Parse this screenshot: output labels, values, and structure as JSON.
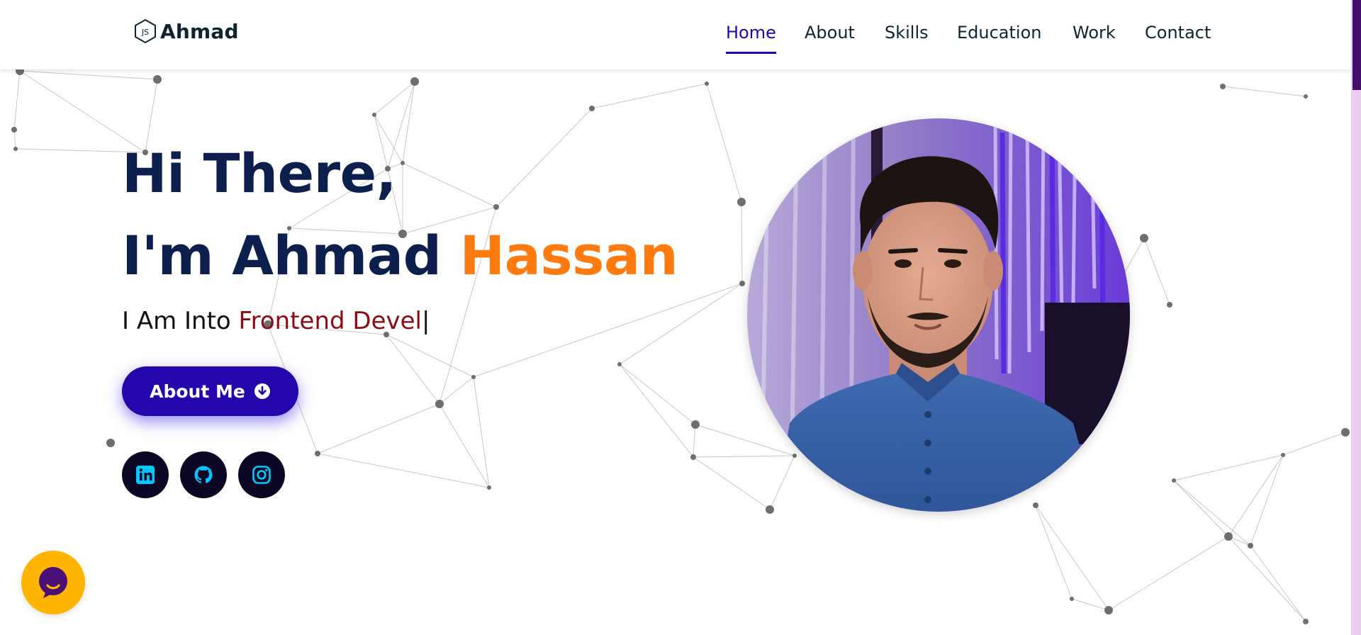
{
  "header": {
    "logo_text": "Ahmad",
    "logo_icon": "js-hexagon-icon",
    "nav": [
      {
        "label": "Home",
        "active": true
      },
      {
        "label": "About",
        "active": false
      },
      {
        "label": "Skills",
        "active": false
      },
      {
        "label": "Education",
        "active": false
      },
      {
        "label": "Work",
        "active": false
      },
      {
        "label": "Contact",
        "active": false
      }
    ]
  },
  "hero": {
    "greeting": "Hi There,",
    "intro_prefix": "I'm Ahmad",
    "intro_highlight": "Hassan",
    "subtitle_prefix": "I Am Into",
    "subtitle_typed": "Frontend Devel",
    "typing_cursor": "|",
    "about_button": {
      "label": "About Me",
      "icon": "arrow-circle-down-icon"
    },
    "socials": [
      {
        "name": "linkedin",
        "icon": "linkedin-icon"
      },
      {
        "name": "github",
        "icon": "github-icon"
      },
      {
        "name": "instagram",
        "icon": "instagram-icon"
      }
    ]
  },
  "profile_photo": {
    "alt": "profile-photo"
  },
  "chat_widget": {
    "icon": "chat-bubble-icon"
  },
  "colors": {
    "primary": "#2506ad",
    "heading": "#0d1f4d",
    "highlight": "#ff7a0f",
    "typed_text": "#8a0c14",
    "social_bg": "#0a0624",
    "social_icon": "#00c8ff",
    "chat_bg": "#ffb400",
    "scroll_thumb": "#420e6e",
    "scroll_track": "#ebcdf4"
  }
}
